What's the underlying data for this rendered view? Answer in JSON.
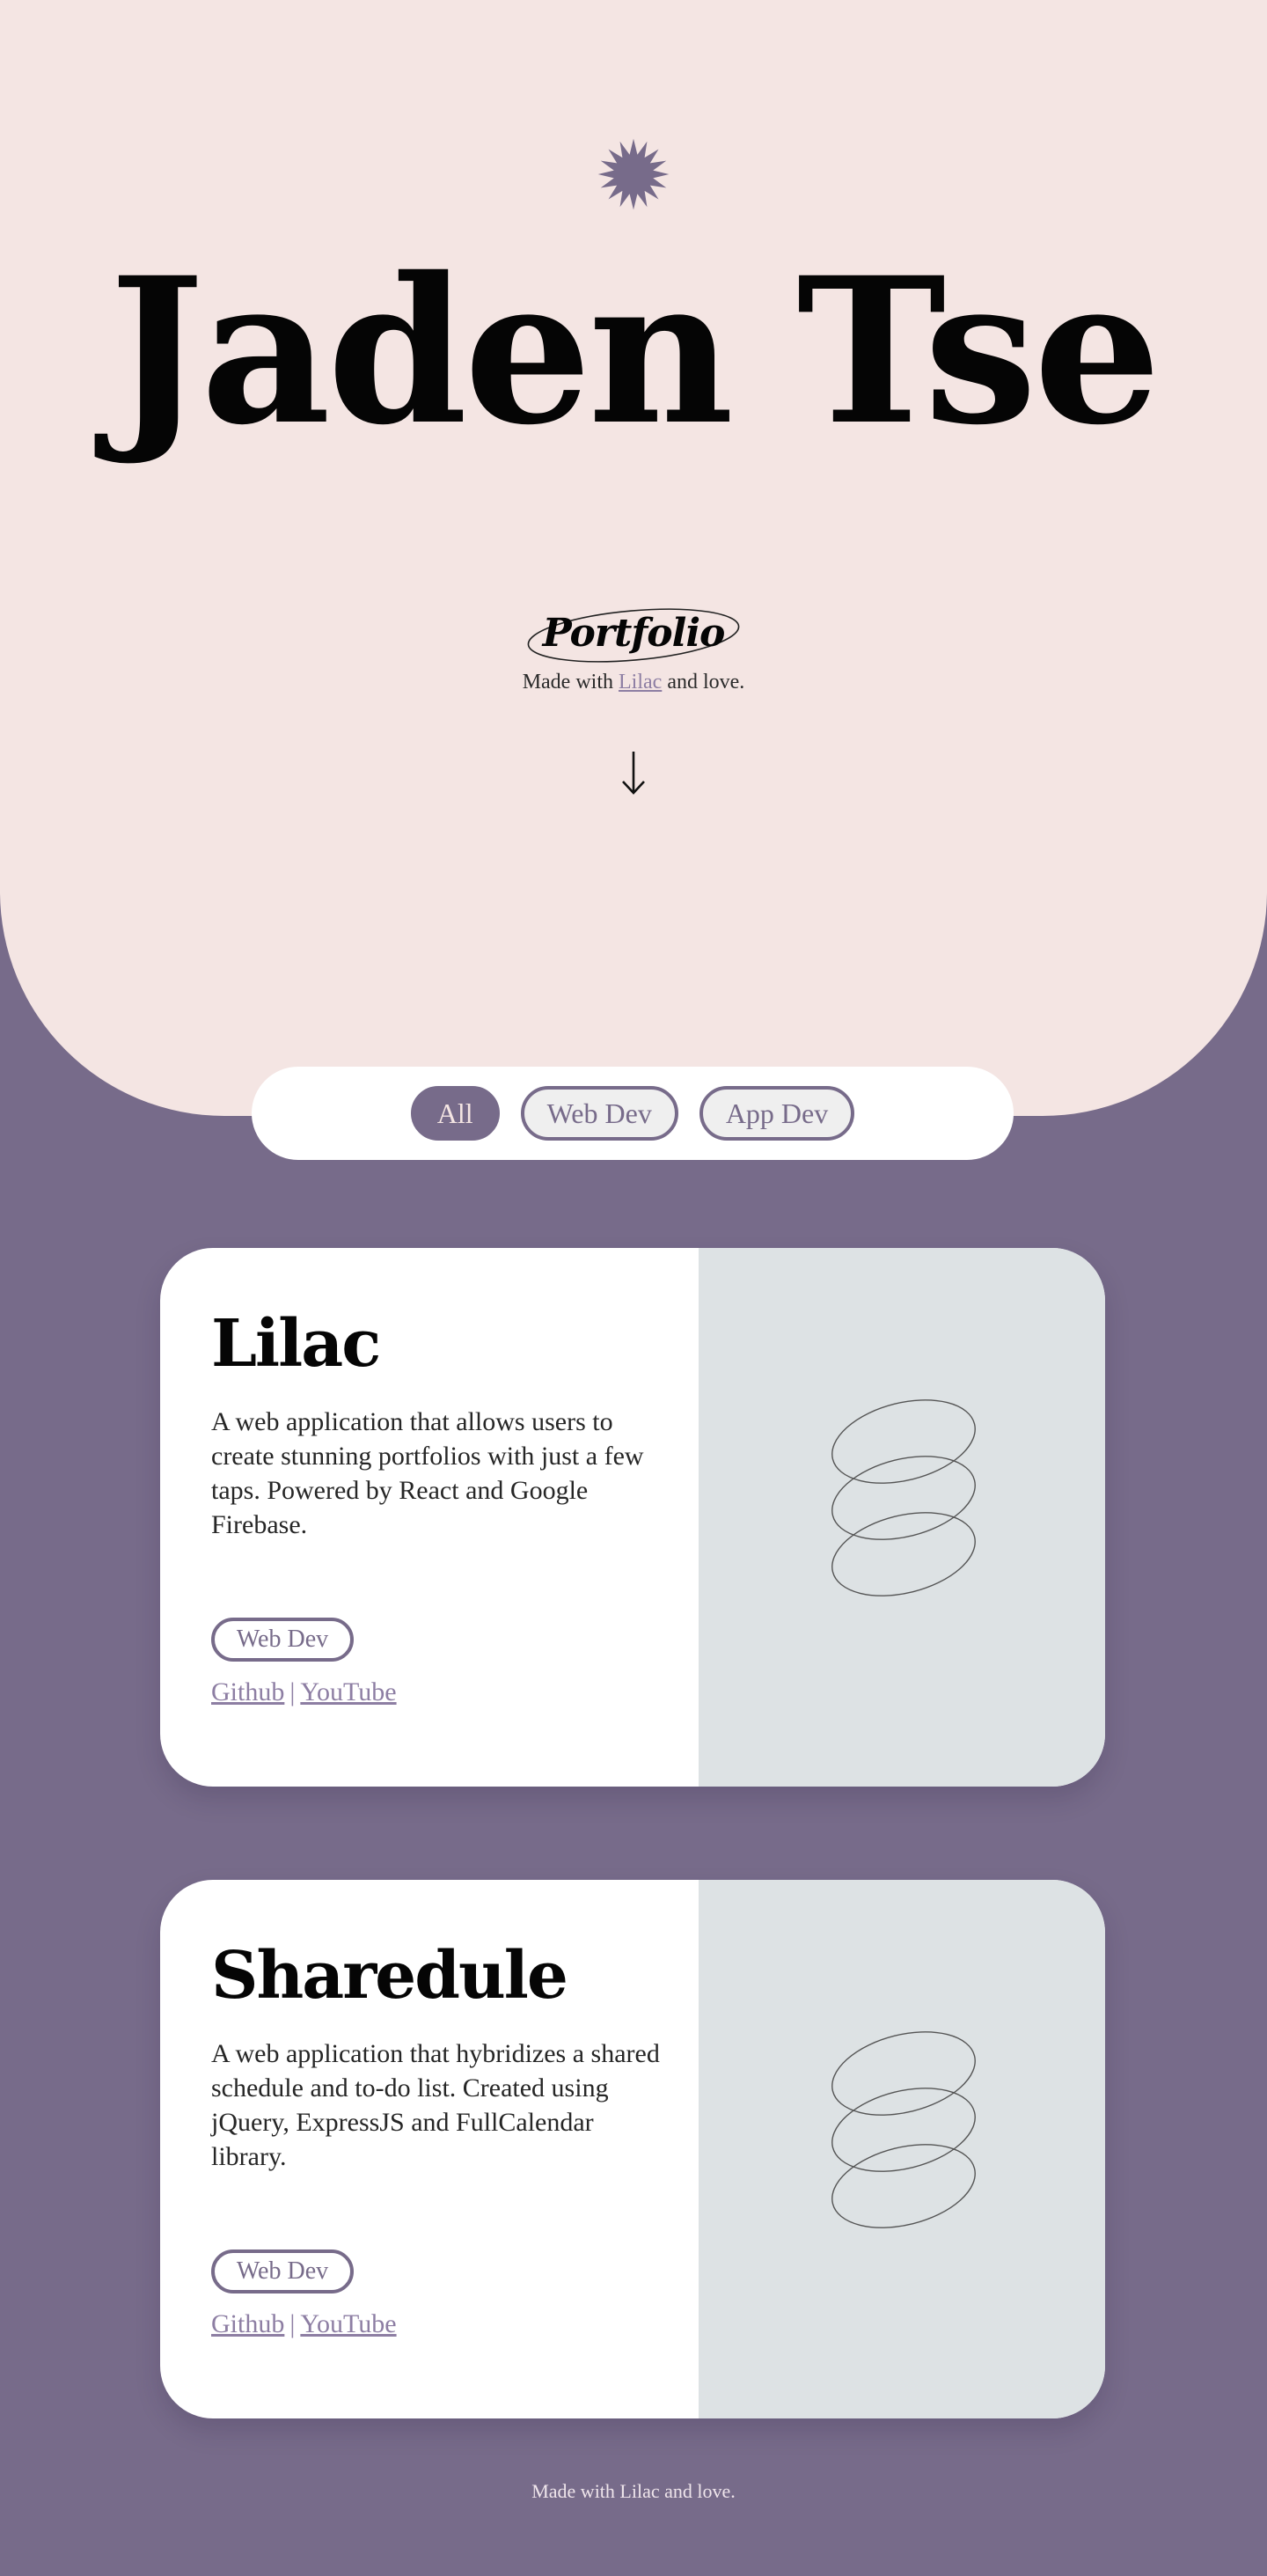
{
  "hero": {
    "name": "Jaden Tse",
    "portfolio_label": "Portfolio",
    "made_with_prefix": "Made with",
    "made_with_link": "Lilac",
    "made_with_suffix": "and love.",
    "star_icon": "star-burst-icon",
    "scroll_icon": "arrow-down-icon"
  },
  "filters": {
    "items": [
      {
        "label": "All",
        "active": true
      },
      {
        "label": "Web Dev",
        "active": false
      },
      {
        "label": "App Dev",
        "active": false
      }
    ]
  },
  "projects": [
    {
      "title": "Lilac",
      "description": "A web application that allows users to create stunning portfolios with just a few taps. Powered by React and Google Firebase.",
      "tag": "Web Dev",
      "links": [
        "Github",
        "YouTube"
      ],
      "separator": "|",
      "media_icon": "stacked-rings-icon"
    },
    {
      "title": "Sharedule",
      "description": "A web application that hybridizes a shared schedule and to-do list. Created using jQuery, ExpressJS and FullCalendar library.",
      "tag": "Web Dev",
      "links": [
        "Github",
        "YouTube"
      ],
      "separator": "|",
      "media_icon": "stacked-rings-icon"
    }
  ],
  "footer": {
    "text": "Made with Lilac and love."
  },
  "colors": {
    "background": "#776b8a",
    "hero_background": "#f4e5e3",
    "accent": "#776b8a",
    "link": "#8d7ea3",
    "media_background": "#dde2e4"
  }
}
